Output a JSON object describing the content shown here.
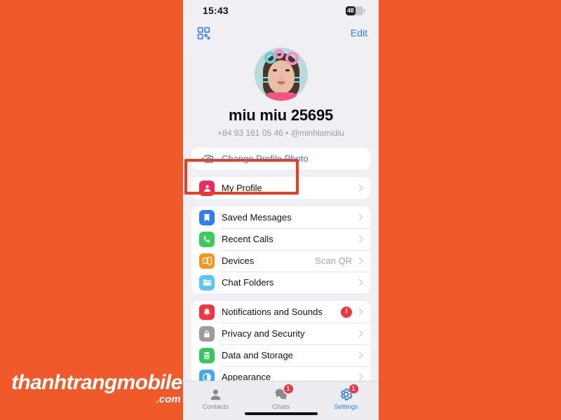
{
  "statusbar": {
    "time": "15:43",
    "battery_level": "48"
  },
  "header": {
    "qr_icon": "qr-code-icon",
    "edit_label": "Edit"
  },
  "profile": {
    "name": "miu miu 25695",
    "subtitle": "+84 93 161 05 46 • @minhlamidiu",
    "avatar_alt": "profile-photo"
  },
  "groups": [
    {
      "rows": [
        {
          "label": "Change Profile Photo",
          "icon": "camera-plus-icon",
          "icon_class": "ic-cam",
          "link": true,
          "chevron": false,
          "value": "",
          "badge": ""
        }
      ]
    },
    {
      "rows": [
        {
          "label": "My Profile",
          "icon": "person-circle-icon",
          "icon_class": "ic-profile",
          "link": false,
          "chevron": true,
          "value": "",
          "badge": ""
        }
      ]
    },
    {
      "rows": [
        {
          "label": "Saved Messages",
          "icon": "bookmark-icon",
          "icon_class": "ic-saved",
          "link": false,
          "chevron": true,
          "value": "",
          "badge": ""
        },
        {
          "label": "Recent Calls",
          "icon": "phone-icon",
          "icon_class": "ic-calls",
          "link": false,
          "chevron": true,
          "value": "",
          "badge": ""
        },
        {
          "label": "Devices",
          "icon": "devices-icon",
          "icon_class": "ic-devices",
          "link": false,
          "chevron": true,
          "value": "Scan QR",
          "badge": ""
        },
        {
          "label": "Chat Folders",
          "icon": "folder-icon",
          "icon_class": "ic-folders",
          "link": false,
          "chevron": true,
          "value": "",
          "badge": ""
        }
      ]
    },
    {
      "rows": [
        {
          "label": "Notifications and Sounds",
          "icon": "bell-icon",
          "icon_class": "ic-notif",
          "link": false,
          "chevron": true,
          "value": "",
          "badge": "!"
        },
        {
          "label": "Privacy and Security",
          "icon": "lock-icon",
          "icon_class": "ic-privacy",
          "link": false,
          "chevron": true,
          "value": "",
          "badge": ""
        },
        {
          "label": "Data and Storage",
          "icon": "database-icon",
          "icon_class": "ic-data",
          "link": false,
          "chevron": true,
          "value": "",
          "badge": ""
        },
        {
          "label": "Appearance",
          "icon": "contrast-circle-icon",
          "icon_class": "ic-appearance",
          "link": false,
          "chevron": true,
          "value": "",
          "badge": ""
        }
      ]
    }
  ],
  "tabbar": {
    "tabs": [
      {
        "label": "Contacts",
        "icon": "person-icon",
        "badge": "",
        "active": false
      },
      {
        "label": "Chats",
        "icon": "chat-bubbles-icon",
        "badge": "1",
        "active": false
      },
      {
        "label": "Settings",
        "icon": "gear-icon",
        "badge": "1",
        "active": true
      }
    ]
  },
  "watermark": {
    "main": "thanhtrangmobile",
    "suffix": ".com"
  },
  "highlight": {
    "target": "My Profile",
    "color": "#E8401F"
  },
  "colors": {
    "background_orange": "#F05A2B",
    "screen_background": "#EFEFF4",
    "accent_blue": "#2F7CF6",
    "badge_red": "#F5333F"
  }
}
